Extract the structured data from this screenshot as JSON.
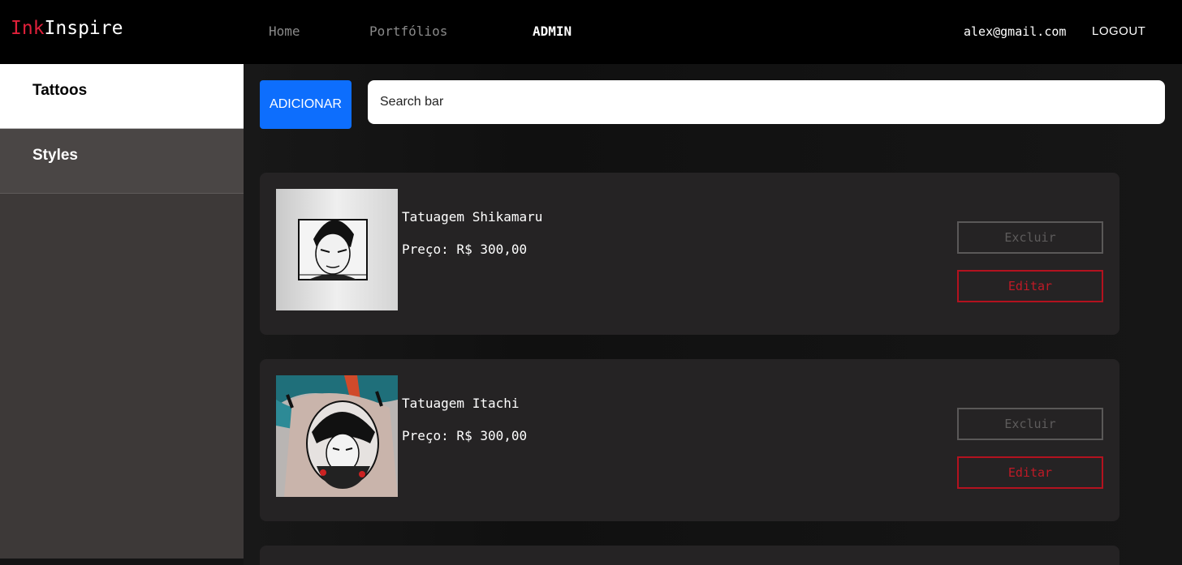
{
  "header": {
    "logo_part1": "Ink",
    "logo_part2": "Inspire",
    "nav": [
      {
        "label": "Home"
      },
      {
        "label": "Portfólios"
      },
      {
        "label": "ADMIN"
      }
    ],
    "user_email": "alex@gmail.com",
    "logout_label": "LOGOUT"
  },
  "sidebar": {
    "items": [
      {
        "label": "Tattoos"
      },
      {
        "label": "Styles"
      }
    ]
  },
  "toolbar": {
    "add_label": "ADICIONAR",
    "search_placeholder": "Search bar"
  },
  "cards": [
    {
      "title": "Tatuagem Shikamaru",
      "price": "Preço: R$ 300,00",
      "delete_label": "Excluir",
      "edit_label": "Editar"
    },
    {
      "title": "Tatuagem Itachi",
      "price": "Preço: R$ 300,00",
      "delete_label": "Excluir",
      "edit_label": "Editar"
    }
  ],
  "colors": {
    "accent_blue": "#0d6efd",
    "accent_red": "#b3121f",
    "logo_red": "#e0203a"
  }
}
